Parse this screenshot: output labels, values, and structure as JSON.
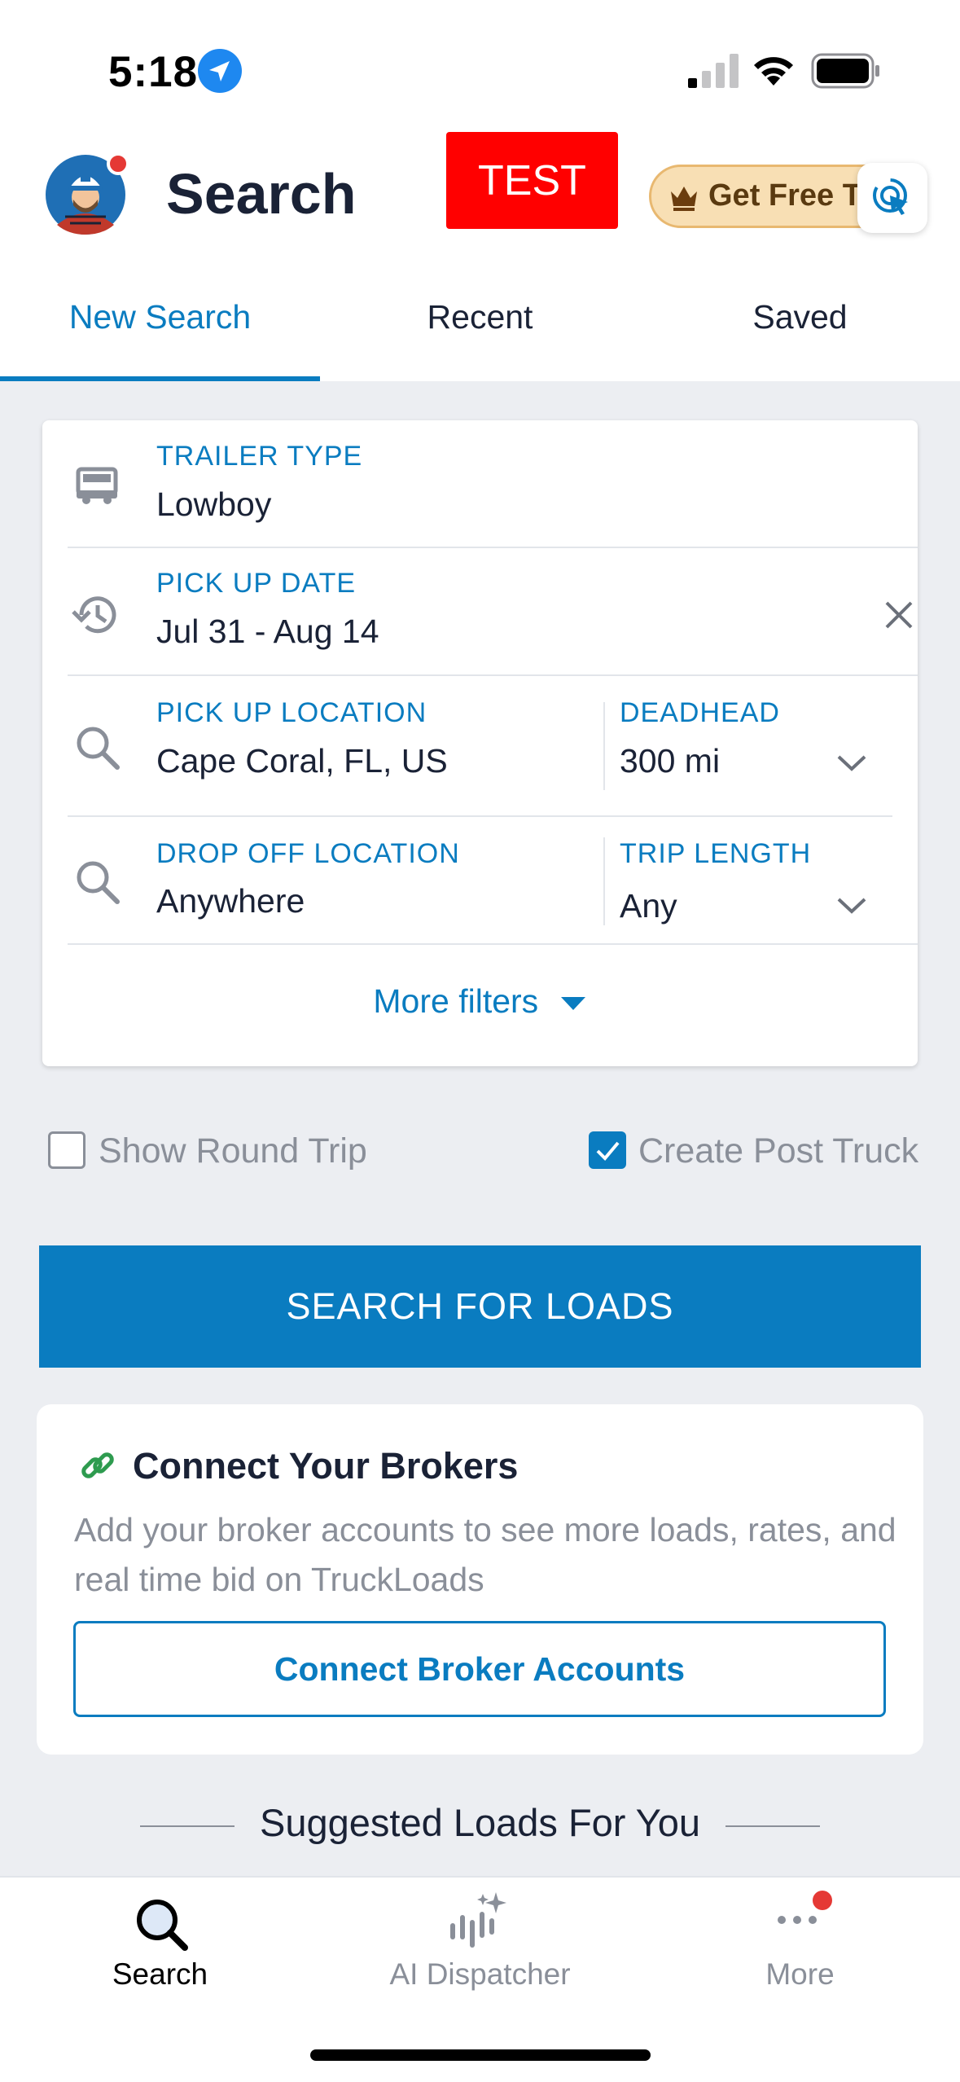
{
  "status_bar": {
    "time": "5:18"
  },
  "header": {
    "title": "Search",
    "test_badge": "TEST",
    "promo_label": "Get Free T"
  },
  "tabs": [
    {
      "label": "New Search",
      "active": true
    },
    {
      "label": "Recent",
      "active": false
    },
    {
      "label": "Saved",
      "active": false
    }
  ],
  "form": {
    "trailer_type": {
      "label": "TRAILER TYPE",
      "value": "Lowboy"
    },
    "pickup_date": {
      "label": "PICK UP DATE",
      "value": "Jul 31 - Aug 14"
    },
    "pickup_location": {
      "label": "PICK UP LOCATION",
      "value": "Cape Coral, FL, US"
    },
    "deadhead": {
      "label": "DEADHEAD",
      "value": "300 mi"
    },
    "dropoff_location": {
      "label": "DROP OFF LOCATION",
      "value": "Anywhere"
    },
    "trip_length": {
      "label": "TRIP LENGTH",
      "value": "Any"
    },
    "more_filters": "More filters"
  },
  "options": {
    "round_trip": {
      "label": "Show Round Trip",
      "checked": false
    },
    "post_truck": {
      "label": "Create Post Truck",
      "checked": true
    }
  },
  "search_button": "SEARCH FOR LOADS",
  "brokers": {
    "title": "Connect Your Brokers",
    "description": "Add your broker accounts to see more loads, rates, and real time bid on TruckLoads",
    "button": "Connect Broker Accounts"
  },
  "suggested_title": "Suggested Loads For You",
  "bottom_nav": [
    {
      "label": "Search",
      "icon": "search-icon",
      "active": true
    },
    {
      "label": "AI Dispatcher",
      "icon": "ai-dispatcher-icon",
      "active": false
    },
    {
      "label": "More",
      "icon": "more-icon",
      "active": false
    }
  ],
  "colors": {
    "accent": "#0a7cc0",
    "test_badge": "#ff0000",
    "notification": "#e53935"
  }
}
